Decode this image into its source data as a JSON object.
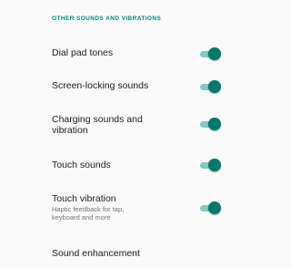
{
  "section": {
    "header": "OTHER SOUNDS AND VIBRATIONS"
  },
  "settings": [
    {
      "title": "Dial pad tones",
      "toggle_on": true
    },
    {
      "title": "Screen-locking sounds",
      "toggle_on": true
    },
    {
      "title_line1": "Charging sounds and",
      "title_line2": "vibration",
      "toggle_on": true
    },
    {
      "title": "Touch sounds",
      "toggle_on": true
    },
    {
      "title": "Touch vibration",
      "summary_line1": "Haptic feedback for tap,",
      "summary_line2": "keyboard and more",
      "toggle_on": true
    },
    {
      "title": "Sound enhancement"
    }
  ],
  "colors": {
    "accent": "#00796b",
    "track": "#80cbc4",
    "header": "#00897b",
    "background": "#fafafa"
  }
}
